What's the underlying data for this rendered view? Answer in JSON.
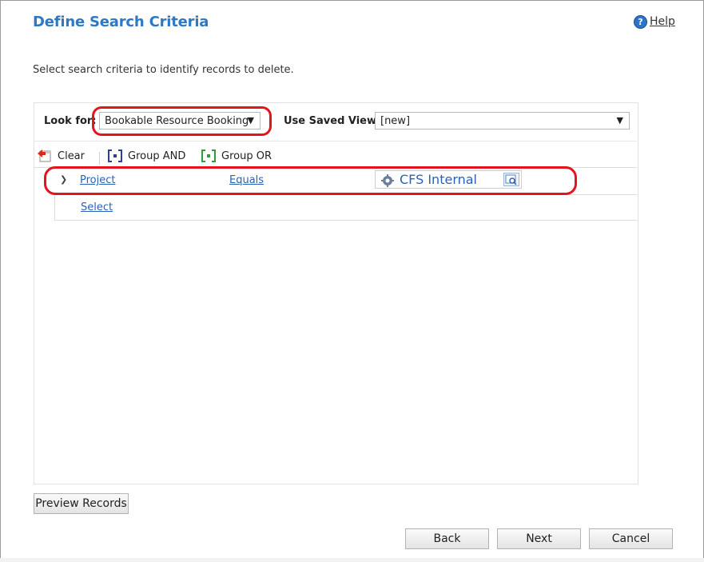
{
  "header": {
    "title": "Define Search Criteria",
    "help_label": "Help",
    "help_icon": "?"
  },
  "instructions": "Select search criteria to identify records to delete.",
  "criteria": {
    "look_for_label": "Look for:",
    "look_for_value": "Bookable Resource Booking",
    "saved_view_label": "Use Saved View:",
    "saved_view_value": "[new]"
  },
  "toolbar": {
    "clear_label": "Clear",
    "group_and_label": "Group AND",
    "group_or_label": "Group OR"
  },
  "condition": {
    "field": "Project",
    "operator": "Equals",
    "value": "CFS Internal"
  },
  "add_row": {
    "select_label": "Select"
  },
  "buttons": {
    "preview_records": "Preview Records",
    "back": "Back",
    "next": "Next",
    "cancel": "Cancel"
  },
  "colors": {
    "title": "#2f78c4",
    "link": "#2a62b8",
    "highlight": "#e3141b"
  }
}
